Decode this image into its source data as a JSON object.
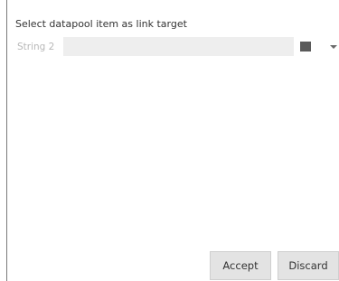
{
  "dialog": {
    "title": "Select datapool item as link target",
    "field": {
      "label": "String 2",
      "value": ""
    },
    "buttons": {
      "accept_label": "Accept",
      "discard_label": "Discard"
    }
  },
  "colors": {
    "field_background": "#eeeeee",
    "button_background": "#e3e3e3",
    "square_button": "#5a5a5a"
  },
  "icons": {
    "square": "stop-square-icon",
    "dropdown": "dropdown-arrow-icon"
  }
}
